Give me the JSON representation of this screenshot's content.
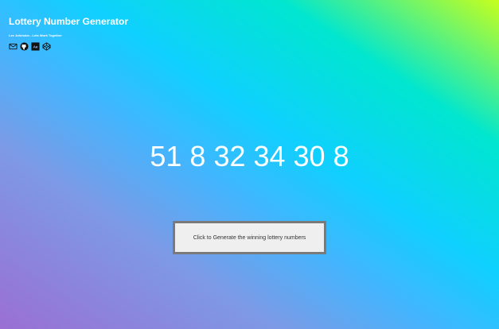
{
  "header": {
    "title": "Lottery Number Generator",
    "subtitle": "Lee Johnston - Lets Work Together",
    "social_icons": [
      "mail-icon",
      "github-icon",
      "adobe-icon",
      "codepen-icon"
    ]
  },
  "main": {
    "numbers_text": "51 8 32 34 30 8"
  },
  "generate_button": {
    "label": "Click to Generate the winning lottery numbers"
  },
  "colors": {
    "text": "#ffffff",
    "button_bg": "#efefef",
    "button_border": "#7a7a7a",
    "gradient_start": "#9a6fd3",
    "gradient_mid": "#0fd0ff",
    "gradient_end": "#c6ff1c"
  }
}
